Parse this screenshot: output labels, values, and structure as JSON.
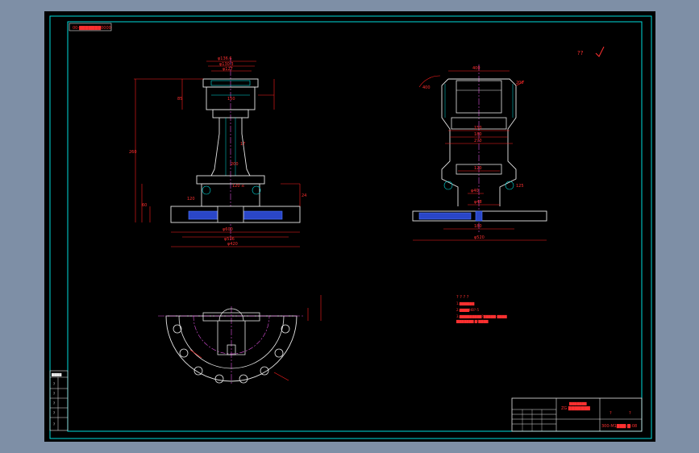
{
  "sheet": {
    "top_left_label": "00-▇▇▇▇▇▇▇0000",
    "revision_mark": "??",
    "bottom_left_header": "▇▇▇▇",
    "bottom_left_rows": [
      "?",
      "?",
      "?",
      "?",
      "?"
    ]
  },
  "front_view": {
    "dims": [
      "φ136.6",
      "φ130.3",
      "φ127",
      "φ127",
      "150",
      "260",
      "φ600",
      "φ536",
      "φ420",
      "200",
      "17",
      "85",
      "60",
      "120",
      "120 ≤",
      "24"
    ]
  },
  "side_view": {
    "dims": [
      "400",
      "150",
      "180",
      "270",
      "400",
      "200",
      "120",
      "125",
      "180",
      "φ520",
      "φ48",
      "φ40"
    ]
  },
  "notes": {
    "heading": "? ? ? ?",
    "lines": [
      "1.▇▇▇▇▇▇",
      "2.▇▇▇▇HB?-5",
      "3.▇▇▇▇▇▇▇▇▇?▇▇▇▇▇-▇▇▇▇",
      "▇▇▇▇▇▇▇.▇/▇▇▇▇"
    ]
  },
  "title_block": {
    "name": "ZG ▇▇▇▇▇▇▇",
    "subtitle": "▇▇▇▇▇▇▇",
    "mark_left": "?",
    "mark_right": "?",
    "drawing_no": "300-M1▇▇▇-▇-08"
  },
  "colors": {
    "border": "#00dcdc",
    "dimension": "#ff1e1e",
    "outline": "#e6e6e6",
    "hatch": "#5078ff",
    "center": "#d94fd9",
    "paper": "#000000",
    "frame": "#7e8fa6"
  }
}
